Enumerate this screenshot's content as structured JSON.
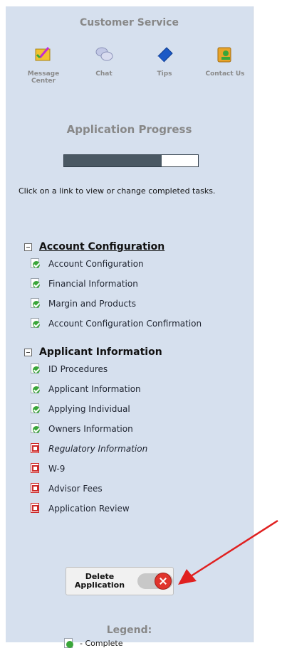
{
  "customer_service": {
    "title": "Customer Service",
    "items": [
      {
        "label": "Message Center",
        "icon": "message-center-icon"
      },
      {
        "label": "Chat",
        "icon": "chat-icon"
      },
      {
        "label": "Tips",
        "icon": "tips-icon"
      },
      {
        "label": "Contact Us",
        "icon": "contact-us-icon"
      }
    ]
  },
  "progress": {
    "title": "Application Progress",
    "fraction": 0.73
  },
  "hint": "Click on a link to view or change completed tasks.",
  "groups": [
    {
      "title": "Account Configuration",
      "tasks": [
        {
          "label": "Account Configuration",
          "status": "complete"
        },
        {
          "label": "Financial Information",
          "status": "complete"
        },
        {
          "label": "Margin and Products",
          "status": "complete"
        },
        {
          "label": "Account Configuration Confirmation",
          "status": "complete"
        }
      ]
    },
    {
      "title": "Applicant Information",
      "tasks": [
        {
          "label": "ID Procedures",
          "status": "complete"
        },
        {
          "label": "Applicant Information",
          "status": "complete"
        },
        {
          "label": "Applying Individual",
          "status": "complete"
        },
        {
          "label": "Owners Information",
          "status": "complete"
        },
        {
          "label": "Regulatory Information",
          "status": "incomplete"
        },
        {
          "label": "W-9",
          "status": "incomplete"
        },
        {
          "label": "Advisor Fees",
          "status": "incomplete"
        },
        {
          "label": "Application Review",
          "status": "incomplete"
        }
      ]
    }
  ],
  "delete_button": {
    "label": "Delete Application"
  },
  "legend": {
    "title": "Legend:",
    "items": [
      {
        "label": "- Complete",
        "status": "complete"
      }
    ]
  },
  "colors": {
    "panel": "#d6e0ee",
    "progress_fill": "#4a5863",
    "complete": "#3aa63a",
    "incomplete": "#cc2a2a",
    "arrow": "#e02020"
  }
}
